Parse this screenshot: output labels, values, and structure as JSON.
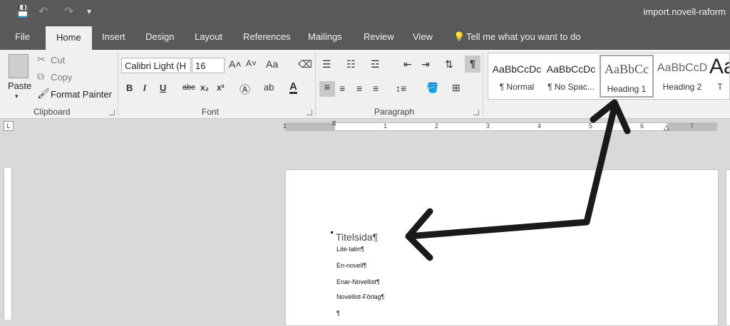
{
  "titlebar": {
    "document_title": "import.novell-raform",
    "qat": {
      "save": "💾",
      "undo": "↶",
      "redo": "↷",
      "customize": "▾"
    }
  },
  "tabs": [
    "File",
    "Home",
    "Insert",
    "Design",
    "Layout",
    "References",
    "Mailings",
    "Review",
    "View"
  ],
  "tell_me": "Tell me what you want to do",
  "clipboard": {
    "paste": "Paste",
    "cut": "Cut",
    "copy": "Copy",
    "format_painter": "Format Painter",
    "group_label": "Clipboard"
  },
  "font": {
    "name": "Calibri Light (H",
    "size": "16",
    "group_label": "Font",
    "grow": "A˄",
    "shrink": "A˅",
    "case": "Aa",
    "bold": "B",
    "italic": "I",
    "underline": "U",
    "strike": "abc",
    "subscript": "x₂",
    "superscript": "x²"
  },
  "paragraph": {
    "group_label": "Paragraph",
    "pilcrow": "¶"
  },
  "styles": [
    {
      "preview": "AaBbCcDc",
      "name": "¶ Normal"
    },
    {
      "preview": "AaBbCcDc",
      "name": "¶ No Spac..."
    },
    {
      "preview": "AaBbCc",
      "name": "Heading 1"
    },
    {
      "preview": "AaBbCcD",
      "name": "Heading 2"
    },
    {
      "preview": "Aa",
      "name": "T"
    }
  ],
  "ruler": {
    "corner": "L",
    "numbers": [
      "1",
      "1",
      "2",
      "3",
      "4",
      "5",
      "6",
      "7"
    ]
  },
  "document": {
    "heading": "Titelsida¶",
    "lines": [
      "Lite-latin¶",
      "En-novell¶",
      "Enar-Novellist¶",
      "Novellist-Förlag¶",
      "¶"
    ]
  },
  "colors": {
    "titlebar": "#595959",
    "ribbon": "#f0f0f0",
    "canvas": "#d9d9d9",
    "arrow": "#1a1a1a"
  }
}
